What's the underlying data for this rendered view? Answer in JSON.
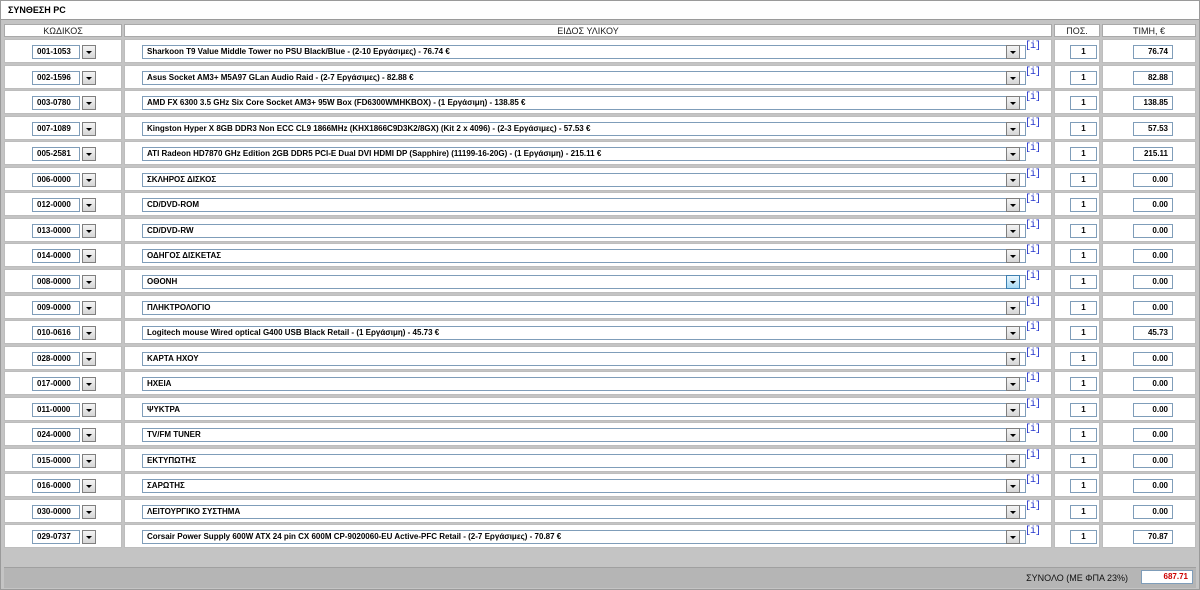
{
  "title": "ΣΥΝΘΕΣΗ PC",
  "columns": {
    "code": "ΚΩΔΙΚΟΣ",
    "item": "ΕΙΔΟΣ ΥΛΙΚΟΥ",
    "qty": "ΠΟΣ.",
    "price": "ΤΙΜΗ, €"
  },
  "info_label": "[i]",
  "rows": [
    {
      "code": "001-1053",
      "description": "Sharkoon T9 Value Middle Tower no PSU Black/Blue - (2-10 Εργάσιμες) - 76.74 €",
      "qty": "1",
      "price": "76.74"
    },
    {
      "code": "002-1596",
      "description": "Asus Socket AM3+ M5A97 GLan Audio Raid - (2-7 Εργάσιμες) - 82.88 €",
      "qty": "1",
      "price": "82.88"
    },
    {
      "code": "003-0780",
      "description": "AMD FX 6300 3.5 GHz Six Core Socket AM3+ 95W Box (FD6300WMHKBOX) - (1 Εργάσιμη) - 138.85 €",
      "qty": "1",
      "price": "138.85"
    },
    {
      "code": "007-1089",
      "description": "Kingston Hyper X 8GB DDR3 Non ECC CL9 1866MHz (KHX1866C9D3K2/8GX) (Kit 2 x 4096) - (2-3 Εργάσιμες) - 57.53 €",
      "qty": "1",
      "price": "57.53"
    },
    {
      "code": "005-2581",
      "description": "ATI Radeon HD7870 GHz Edition 2GB DDR5 PCI-E Dual DVI HDMI DP (Sapphire) (11199-16-20G) - (1 Εργάσιμη) - 215.11 €",
      "qty": "1",
      "price": "215.11"
    },
    {
      "code": "006-0000",
      "description": "ΣΚΛΗΡΟΣ ΔΙΣΚΟΣ",
      "qty": "1",
      "price": "0.00"
    },
    {
      "code": "012-0000",
      "description": "CD/DVD-ROM",
      "qty": "1",
      "price": "0.00"
    },
    {
      "code": "013-0000",
      "description": "CD/DVD-RW",
      "qty": "1",
      "price": "0.00"
    },
    {
      "code": "014-0000",
      "description": "ΟΔΗΓΟΣ ΔΙΣΚΕΤΑΣ",
      "qty": "1",
      "price": "0.00"
    },
    {
      "code": "008-0000",
      "description": "ΟΘΟΝΗ",
      "qty": "1",
      "price": "0.00"
    },
    {
      "code": "009-0000",
      "description": "ΠΛΗΚΤΡΟΛΟΓΙΟ",
      "qty": "1",
      "price": "0.00"
    },
    {
      "code": "010-0616",
      "description": "Logitech mouse Wired optical G400 USB Black Retail - (1 Εργάσιμη) - 45.73 €",
      "qty": "1",
      "price": "45.73"
    },
    {
      "code": "028-0000",
      "description": "ΚΑΡΤΑ ΗΧΟΥ",
      "qty": "1",
      "price": "0.00"
    },
    {
      "code": "017-0000",
      "description": "ΗΧΕΙΑ",
      "qty": "1",
      "price": "0.00"
    },
    {
      "code": "011-0000",
      "description": "ΨΥΚΤΡΑ",
      "qty": "1",
      "price": "0.00"
    },
    {
      "code": "024-0000",
      "description": "TV/FM TUNER",
      "qty": "1",
      "price": "0.00"
    },
    {
      "code": "015-0000",
      "description": "ΕΚΤΥΠΩΤΗΣ",
      "qty": "1",
      "price": "0.00"
    },
    {
      "code": "016-0000",
      "description": "ΣΑΡΩΤΗΣ",
      "qty": "1",
      "price": "0.00"
    },
    {
      "code": "030-0000",
      "description": "ΛΕΙΤΟΥΡΓΙΚΟ ΣΥΣΤΗΜΑ",
      "qty": "1",
      "price": "0.00"
    },
    {
      "code": "029-0737",
      "description": "Corsair Power Supply 600W ATX 24 pin CX 600M CP-9020060-EU Active-PFC Retail - (2-7 Εργάσιμες) - 70.87 €",
      "qty": "1",
      "price": "70.87"
    }
  ],
  "total": {
    "label": "ΣΥΝΟΛΟ (ΜΕ ΦΠΑ 23%)",
    "value": "687.71",
    "value_color": "#cc0000"
  },
  "icons": {
    "dropdown": "chevron-down-icon",
    "info": "info-icon"
  }
}
